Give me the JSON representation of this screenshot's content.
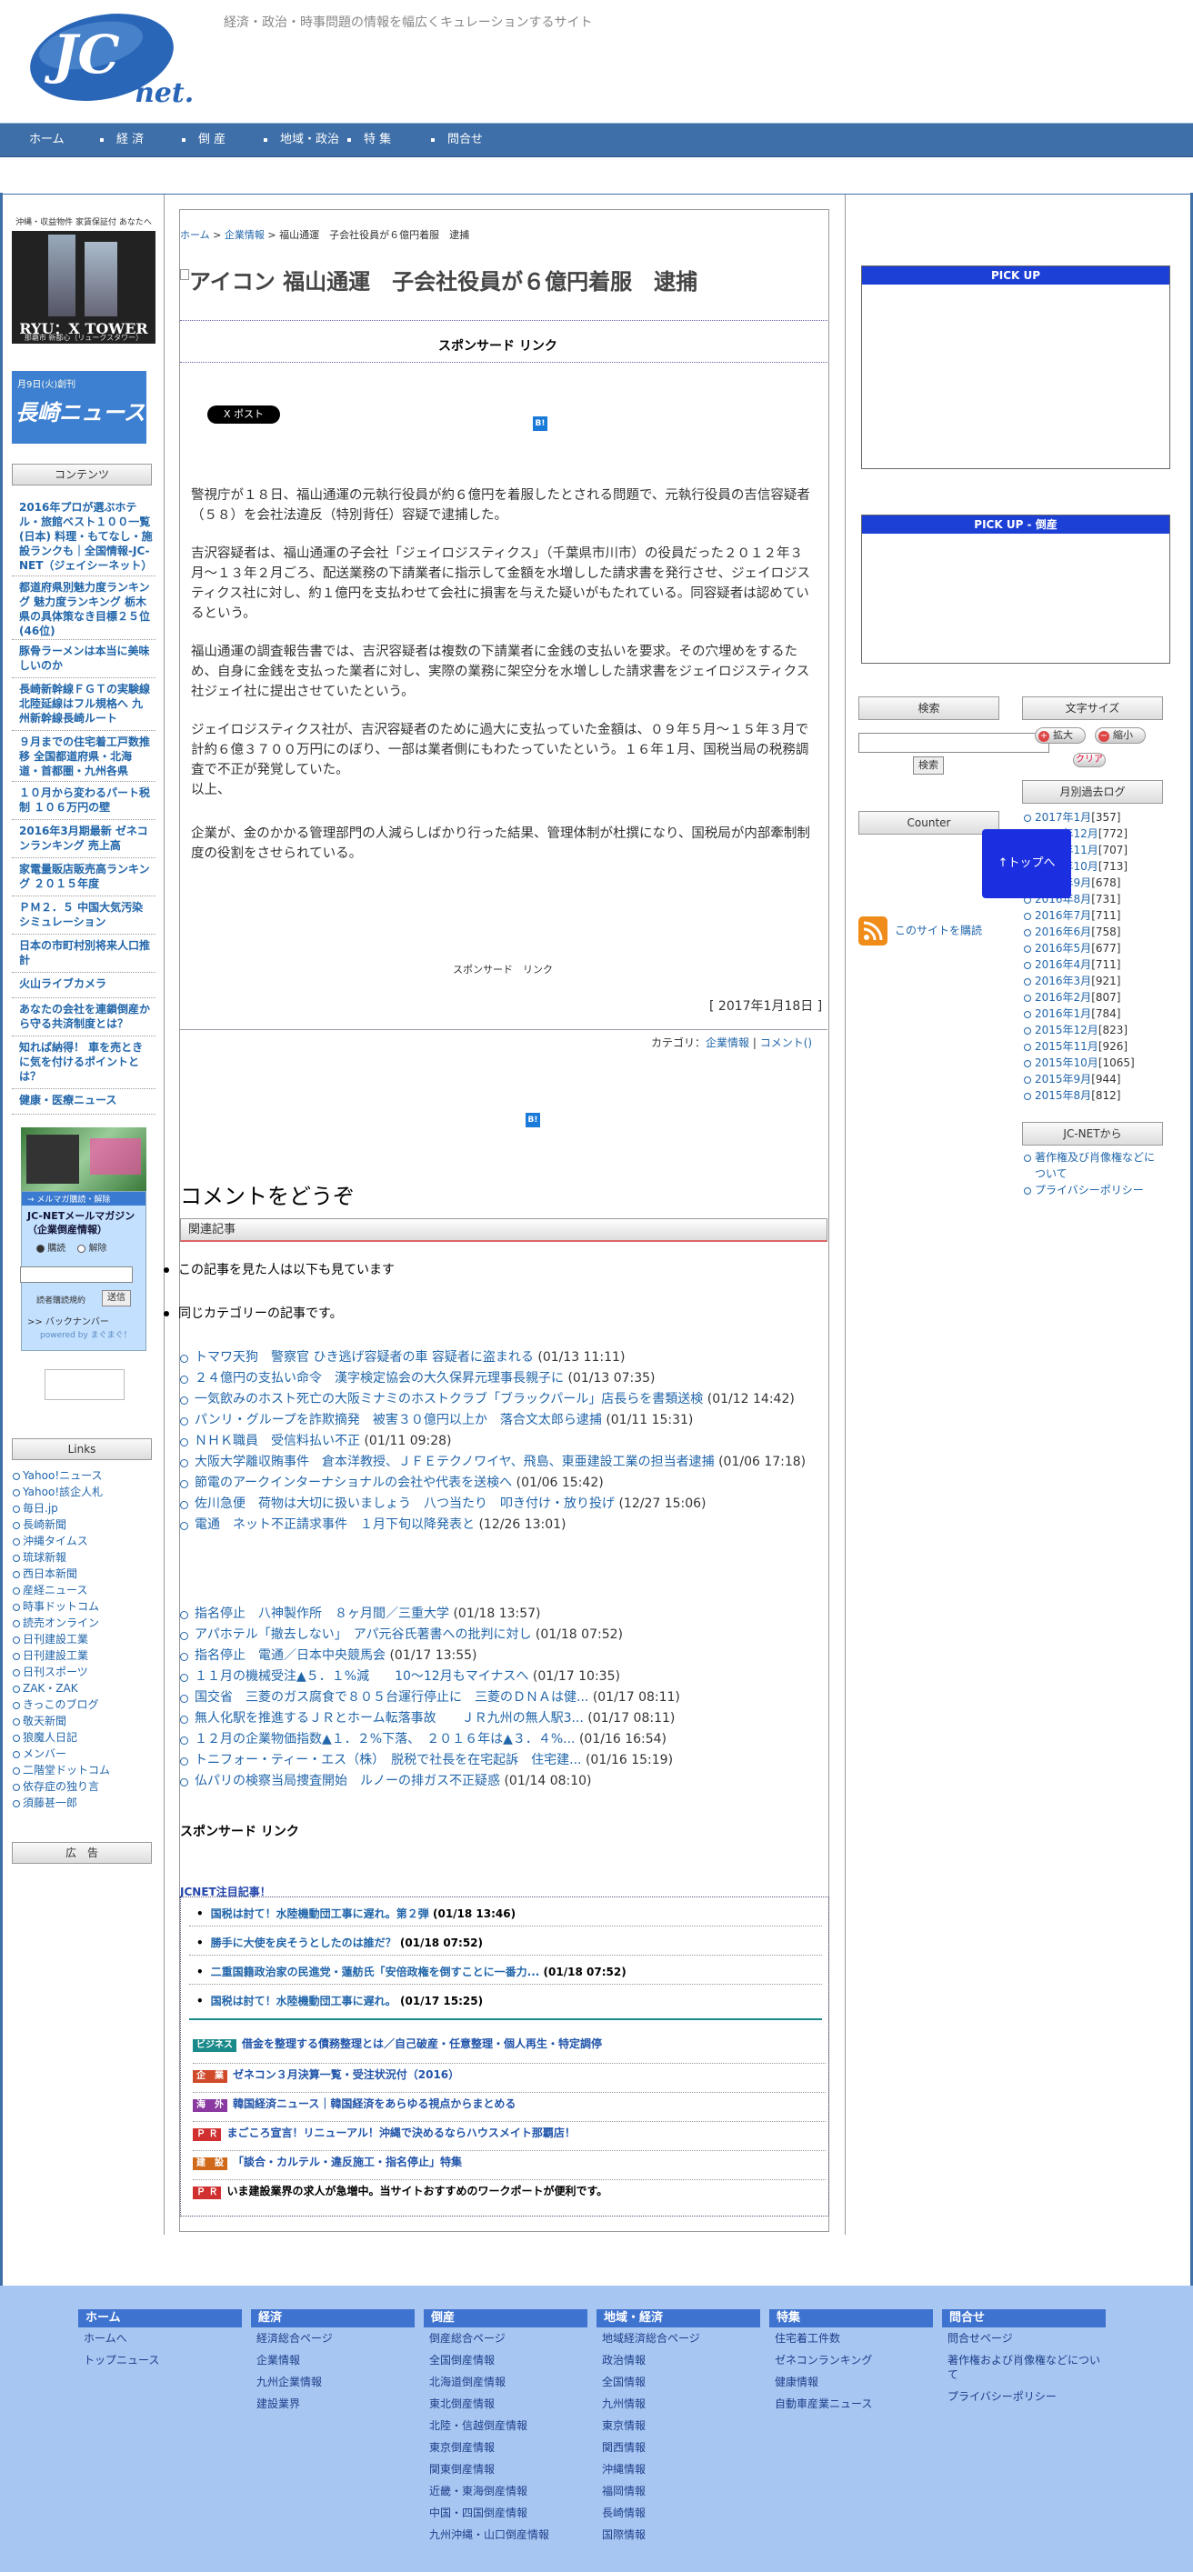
{
  "header": {
    "logo_text": "JC net.",
    "tagline": "経済・政治・時事問題の情報を幅広くキュレーションするサイト"
  },
  "gnav": [
    {
      "label": "ホーム"
    },
    {
      "label": "経 済"
    },
    {
      "label": "倒 産"
    },
    {
      "label": "地域・政治"
    },
    {
      "label": "特 集"
    },
    {
      "label": "問合せ"
    }
  ],
  "left": {
    "banner1": {
      "top": "沖縄・収益物件 家賃保証付 あなたへ",
      "title": "RYU：X TOWER",
      "sub": "那覇市 新都心（リュークスタワー）"
    },
    "banner2": {
      "top": "月9日(火)創刊",
      "title": "長崎ニュース"
    },
    "contents_title": "コンテンツ",
    "contents": [
      "2016年プロが選ぶホテル・旅館ベスト１００一覧(日本) 料理・もてなし・施設ランクも｜全国情報-JC-NET（ジェイシーネット）",
      "都道府県別魅力度ランキング 魅力度ランキング 栃木県の具体策なき目標２５位(46位)",
      "豚骨ラーメンは本当に美味しいのか",
      "長崎新幹線ＦＧＴの実験線 北陸延線はフル規格へ 九州新幹線長崎ルート",
      "９月までの住宅着工戸数推移 全国都道府県・北海道・首都圏・九州各県",
      "１０月から変わるパート税制 １０６万円の壁",
      "2016年3月期最新 ゼネコンランキング 売上高",
      "家電量販店販売高ランキング ２０１５年度",
      "ＰＭ２．５ 中国大気汚染シミュレーション",
      "日本の市町村別将来人口推計",
      "火山ライブカメラ",
      "あなたの会社を連鎖倒産から守る共済制度とは？",
      "知れば納得！ 車を売ときに気を付けるポイントとは？",
      "健康・医療ニュース"
    ],
    "mag": {
      "strip": "→ メルマガ購読・解除",
      "title": "JC-NETメールマガジン（企業倒産情報）",
      "opt1": "購読",
      "opt2": "解除",
      "input_placeholder": "",
      "rules": "読者購読規約",
      "submit": "送信",
      "backnumber": ">> バックナンバー",
      "powered": "powered by まぐまぐ！"
    },
    "links_title": "Links",
    "links": [
      "Yahoo!ニュース",
      "Yahoo!該企人札",
      "毎日.jp",
      "長崎新聞",
      "沖縄タイムス",
      "琉球新報",
      "西日本新聞",
      "産経ニュース",
      "時事ドットコム",
      "読売オンライン",
      "日刊建設工業",
      "日刊建設工業",
      "日刊スポーツ",
      "ZAK・ZAK",
      "きっこのブログ",
      "敬天新聞",
      "狼魔人日記",
      "メンバー",
      "二階堂ドットコム",
      "依存症の独り言",
      "須藤甚一郎"
    ],
    "ad_title": "広　告"
  },
  "main": {
    "breadcrumb": {
      "home": "ホーム",
      "sep1": ">",
      "cat": "企業情報",
      "sep2": ">",
      "current": "福山通運　子会社役員が６億円着服　逮捕"
    },
    "title": "アイコン 福山通運　子会社役員が６億円着服　逮捕",
    "sponsor1": "スポンサード リンク",
    "post_button": "X ポスト",
    "hatena": "B!",
    "paragraphs": [
      "警視庁が１８日、福山通運の元執行役員が約６億円を着服したとされる問題で、元執行役員の吉信容疑者（５８）を会社法違反（特別背任）容疑で逮捕した。",
      "吉沢容疑者は、福山通運の子会社「ジェイロジスティクス」（千葉県市川市）の役員だった２０１２年３月〜１３年２月ごろ、配送業務の下請業者に指示して金額を水増しした請求書を発行させ、ジェイロジスティクス社に対し、約１億円を支払わせて会社に損害を与えた疑いがもたれている。同容疑者は認めているという。",
      "福山通運の調査報告書では、吉沢容疑者は複数の下請業者に金銭の支払いを要求。その穴埋めをするため、自身に金銭を支払った業者に対し、実際の業務に架空分を水増しした請求書をジェイロジスティクス社ジェイ社に提出させていたという。",
      "ジェイロジスティクス社が、吉沢容疑者のために過大に支払っていた金額は、０９年５月〜１５年３月で計約６億３７００万円にのぼり、一部は業者側にもわたっていたという。１６年１月、国税当局の税務調査で不正が発覚していた。\n以上、",
      "企業が、金のかかる管理部門の人減らしばかり行った結果、管理体制が杜撰になり、国税局が内部牽制制度の役割をさせられている。"
    ],
    "sponsor2": "スポンサード　リンク",
    "date": "[ 2017年1月18日 ]",
    "category_label": "カテゴリ：",
    "category": "企業情報",
    "comment_link": "コメント()",
    "comment_heading": "コメントをどうぞ",
    "related_label": "関連記事",
    "bullet1": "この記事を見た人は以下も見ています",
    "bullet2": "同じカテゴリーの記事です。",
    "related_a": [
      {
        "t": "トマワ天狗　警察官 ひき逃げ容疑者の車 容疑者に盗まれる",
        "d": "(01/13 11:11)"
      },
      {
        "t": "２４億円の支払い命令　漢字検定協会の大久保昇元理事長親子に",
        "d": "(01/13 07:35)"
      },
      {
        "t": "一気飲みのホスト死亡の大阪ミナミのホストクラブ「ブラックパール」店長らを書類送検",
        "d": "(01/12 14:42)"
      },
      {
        "t": "パンリ・グループを詐欺摘発　被害３０億円以上か　落合文太郎ら逮捕",
        "d": "(01/11 15:31)"
      },
      {
        "t": "ＮＨＫ職員　受信料払い不正",
        "d": "(01/11 09:28)"
      },
      {
        "t": "大阪大学離収賄事件　倉本洋教授、ＪＦＥテクノワイヤ、飛島、東亜建設工業の担当者逮捕",
        "d": "(01/06 17:18)"
      },
      {
        "t": "節電のアークインターナショナルの会社や代表を送検へ",
        "d": "(01/06 15:42)"
      },
      {
        "t": "佐川急便　荷物は大切に扱いましょう　八つ当たり　叩き付け・放り投げ",
        "d": "(12/27 15:06)"
      },
      {
        "t": "電通　ネット不正請求事件　１月下旬以降発表と",
        "d": "(12/26 13:01)"
      }
    ],
    "related_b": [
      {
        "t": "指名停止　八神製作所　８ヶ月間／三重大学",
        "d": "(01/18 13:57)"
      },
      {
        "t": "アパホテル「撤去しない」　アパ元谷氏著書への批判に対し",
        "d": "(01/18 07:52)"
      },
      {
        "t": "指名停止　電通／日本中央競馬会",
        "d": "(01/17 13:55)"
      },
      {
        "t": "１１月の機械受注▲５．１%減　　10〜12月もマイナスへ",
        "d": "(01/17 10:35)"
      },
      {
        "t": "国交省　三菱のガス腐食で８０５台運行停止に　三菱のＤＮＡは健...",
        "d": "(01/17 08:11)"
      },
      {
        "t": "無人化駅を推進するＪＲとホーム転落事故　　ＪＲ九州の無人駅3...",
        "d": "(01/17 08:11)"
      },
      {
        "t": "１２月の企業物価指数▲１．２%下落、　２０１６年は▲３．４%...",
        "d": "(01/16 16:54)"
      },
      {
        "t": "トニフォー・ティー・エス（株）　脱税で社長を在宅起訴　住宅建...",
        "d": "(01/16 15:19)"
      },
      {
        "t": "仏パリの検察当局捜査開始　ルノーの排ガス不正疑惑",
        "d": "(01/14 08:10)"
      }
    ],
    "sponsor3": "スポンサード リンク",
    "jc_title": "JCNET注目記事！",
    "jc_items": [
      {
        "t": "国税は討て！水陸機動団工事に遅れ。第２弾",
        "d": "(01/18 13:46)"
      },
      {
        "t": "勝手に大使を戻そうとしたのは誰だ？",
        "d": "(01/18 07:52)"
      },
      {
        "t": "二重国籍政治家の民進党・蓮舫氏「安倍政権を倒すことに一番力...",
        "d": "(01/18 07:52)"
      },
      {
        "t": "国税は討て！水陸機動団工事に遅れ。",
        "d": "(01/17 15:25)"
      }
    ],
    "promo": [
      {
        "tag": "ビジネス",
        "color": "#1a8a8a",
        "t": "借金を整理する債務整理とは／自己破産・任意整理・個人再生・特定調停"
      },
      {
        "tag": "企　業",
        "color": "#d04a2a",
        "t": "ゼネコン３月決算一覧・受注状況付（2016）"
      },
      {
        "tag": "海　外",
        "color": "#8a3aa0",
        "t": "韓国経済ニュース｜韓国経済をあらゆる視点からまとめる"
      },
      {
        "tag": "Ｐ Ｒ",
        "color": "#d03030",
        "t": "まごころ宣言！リニューアル！沖縄で決めるならハウスメイト那覇店！"
      },
      {
        "tag": "建　設",
        "color": "#d06a1a",
        "t": "「談合・カルテル・違反施工・指名停止」特集"
      },
      {
        "tag": "Ｐ Ｒ",
        "color": "#d03030",
        "t": "いま建設業界の求人が急増中。当サイトおすすめのワークポートが便利です。"
      }
    ]
  },
  "right": {
    "pickup1": "PICK UP",
    "pickup2": "PICK UP - 倒産",
    "search_title": "検索",
    "search_button": "検索",
    "fontsize_title": "文字サイズ",
    "font_big": "拡大",
    "font_small": "縮小",
    "font_clear": "クリア",
    "counter_title": "Counter",
    "archive_title": "月別過去ログ",
    "archive": [
      {
        "m": "2017年1月",
        "n": "[357]"
      },
      {
        "m": "2016年12月",
        "n": "[772]"
      },
      {
        "m": "2016年11月",
        "n": "[707]"
      },
      {
        "m": "2016年10月",
        "n": "[713]"
      },
      {
        "m": "2016年9月",
        "n": "[678]"
      },
      {
        "m": "2016年8月",
        "n": "[731]"
      },
      {
        "m": "2016年7月",
        "n": "[711]"
      },
      {
        "m": "2016年6月",
        "n": "[758]"
      },
      {
        "m": "2016年5月",
        "n": "[677]"
      },
      {
        "m": "2016年4月",
        "n": "[711]"
      },
      {
        "m": "2016年3月",
        "n": "[921]"
      },
      {
        "m": "2016年2月",
        "n": "[807]"
      },
      {
        "m": "2016年1月",
        "n": "[784]"
      },
      {
        "m": "2015年12月",
        "n": "[823]"
      },
      {
        "m": "2015年11月",
        "n": "[926]"
      },
      {
        "m": "2015年10月",
        "n": "[1065]"
      },
      {
        "m": "2015年9月",
        "n": "[944]"
      },
      {
        "m": "2015年8月",
        "n": "[812]"
      }
    ],
    "rss_label": "このサイトを購読",
    "totop": "↑トップへ",
    "jcnet_title": "JC-NETから",
    "jcnet_links": [
      "著作権及び肖像権などについて",
      "プライバシーポリシー"
    ]
  },
  "footer": {
    "cols": [
      {
        "h": "ホーム",
        "items": [
          "ホームへ",
          "トップニュース"
        ]
      },
      {
        "h": "経済",
        "items": [
          "経済総合ページ",
          "企業情報",
          "九州企業情報",
          "建設業界"
        ]
      },
      {
        "h": "倒産",
        "items": [
          "倒産総合ページ",
          "全国倒産情報",
          "北海道倒産情報",
          "東北倒産情報",
          "北陸・信越倒産情報",
          "東京倒産情報",
          "関東倒産情報",
          "近畿・東海倒産情報",
          "中国・四国倒産情報",
          "九州沖縄・山口倒産情報"
        ]
      },
      {
        "h": "地域・経済",
        "items": [
          "地域経済総合ページ",
          "政治情報",
          "全国情報",
          "九州情報",
          "東京情報",
          "関西情報",
          "沖縄情報",
          "福岡情報",
          "長崎情報",
          "国際情報"
        ]
      },
      {
        "h": "特集",
        "items": [
          "住宅着工件数",
          "ゼネコンランキング",
          "健康情報",
          "自動車産業ニュース"
        ]
      },
      {
        "h": "問合せ",
        "items": [
          "問合せページ",
          "著作権および肖像権などについて",
          "プライバシーポリシー"
        ]
      }
    ]
  }
}
